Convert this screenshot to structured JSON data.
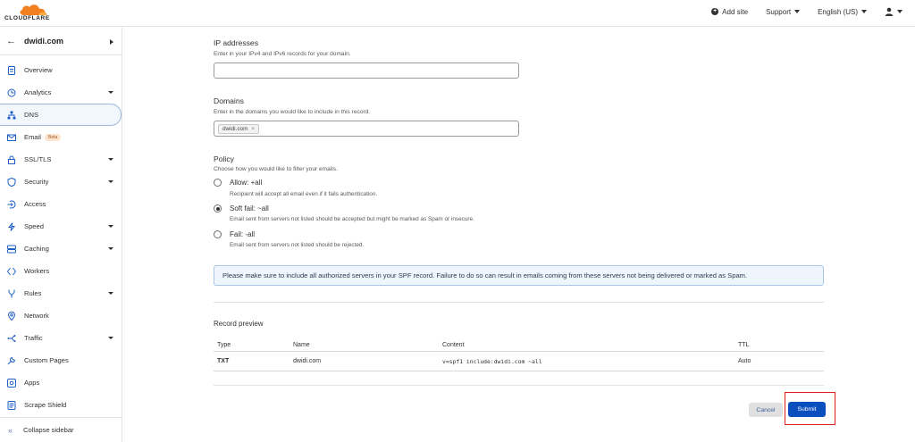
{
  "header": {
    "logo_text": "CLOUDFLARE",
    "add_site": "Add site",
    "support": "Support",
    "language": "English (US)"
  },
  "sidebar": {
    "domain": "dwidi.com",
    "items": [
      {
        "label": "Overview",
        "icon": "document-icon",
        "has_chevron": false
      },
      {
        "label": "Analytics",
        "icon": "clock-chart-icon",
        "has_chevron": true
      },
      {
        "label": "DNS",
        "icon": "network-tree-icon",
        "has_chevron": false,
        "active": true
      },
      {
        "label": "Email",
        "icon": "envelope-icon",
        "has_chevron": false,
        "badge": "Beta"
      },
      {
        "label": "SSL/TLS",
        "icon": "lock-icon",
        "has_chevron": true
      },
      {
        "label": "Security",
        "icon": "shield-icon",
        "has_chevron": true
      },
      {
        "label": "Access",
        "icon": "access-arrow-icon",
        "has_chevron": false
      },
      {
        "label": "Speed",
        "icon": "lightning-icon",
        "has_chevron": true
      },
      {
        "label": "Caching",
        "icon": "server-icon",
        "has_chevron": true
      },
      {
        "label": "Workers",
        "icon": "workers-icon",
        "has_chevron": false
      },
      {
        "label": "Rules",
        "icon": "fork-icon",
        "has_chevron": true
      },
      {
        "label": "Network",
        "icon": "location-pin-icon",
        "has_chevron": false
      },
      {
        "label": "Traffic",
        "icon": "traffic-icon",
        "has_chevron": true
      },
      {
        "label": "Custom Pages",
        "icon": "wrench-icon",
        "has_chevron": false
      },
      {
        "label": "Apps",
        "icon": "apps-icon",
        "has_chevron": false
      },
      {
        "label": "Scrape Shield",
        "icon": "scrape-shield-icon",
        "has_chevron": false
      }
    ],
    "collapse_label": "Collapse sidebar"
  },
  "form": {
    "ip_title": "IP addresses",
    "ip_sub": "Enter in your IPv4 and IPv6 records for your domain.",
    "ip_value": "",
    "domains_title": "Domains",
    "domains_sub": "Enter in the domains you would like to include in this record.",
    "domain_chip": "dwidi.com",
    "domain_chip_remove": "×",
    "policy_title": "Policy",
    "policy_sub": "Choose how you would like to filter your emails.",
    "policies": [
      {
        "label": "Allow: +all",
        "desc": "Recipient will accept all email even if it fails authentication.",
        "checked": false
      },
      {
        "label": "Soft fail: ~all",
        "desc": "Email sent from servers not listed should be accepted but might be marked as Spam or insecure.",
        "checked": true
      },
      {
        "label": "Fail: -all",
        "desc": "Email sent from servers not listed should be rejected.",
        "checked": false
      }
    ],
    "notice": "Please make sure to include all authorized servers in your SPF record. Failure to do so can result in emails coming from these servers not being delivered or marked as Spam."
  },
  "preview": {
    "title": "Record preview",
    "columns": [
      "Type",
      "Name",
      "Content",
      "TTL"
    ],
    "row": [
      "TXT",
      "dwidi.com",
      "v=spf1 include:dwidi.com ~all",
      "Auto"
    ]
  },
  "actions": {
    "cancel": "Cancel",
    "submit": "Submit"
  },
  "colors": {
    "primary": "#0b4fbf",
    "highlight": "#e02020",
    "logo_orange": "#f38020"
  }
}
